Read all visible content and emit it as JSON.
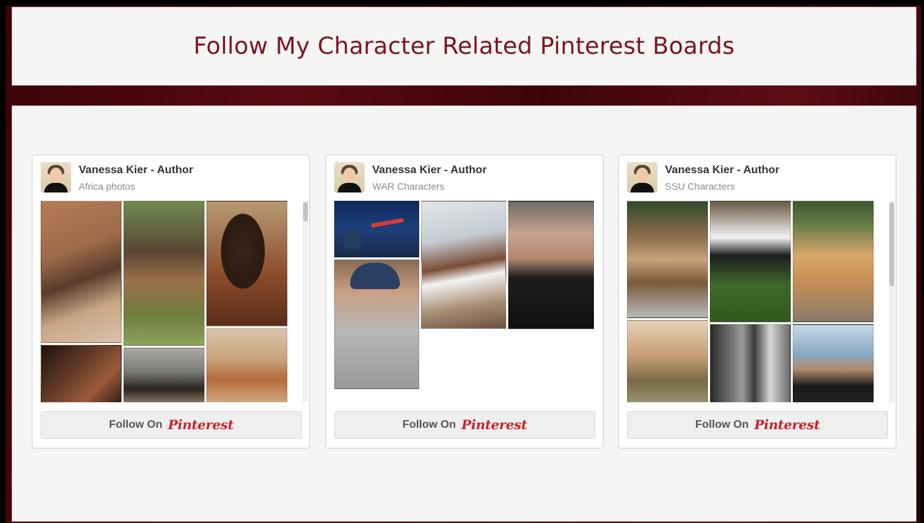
{
  "page": {
    "title": "Follow My Character Related Pinterest Boards"
  },
  "colors": {
    "accent": "#7a1520",
    "pinterest_red": "#cb2027",
    "frame": "#4a0810"
  },
  "widgets": [
    {
      "pinner": "Vanessa Kier - Author",
      "board": "Africa photos",
      "follow_label": "Follow On",
      "brand": "Pinterest",
      "scroll_position": 0.0,
      "images": [
        {
          "subject": "mud hut doorway with seated man"
        },
        {
          "subject": "women carrying pots on heads"
        },
        {
          "subject": "smiling woman with beaded necklaces"
        },
        {
          "subject": "child in doorway"
        },
        {
          "subject": "two children"
        },
        {
          "subject": "figure in ochre fabric"
        }
      ]
    },
    {
      "pinner": "Vanessa Kier - Author",
      "board": "WAR Characters",
      "follow_label": "Follow On",
      "brand": "Pinterest",
      "scroll_position": 0.0,
      "images": [
        {
          "subject": "dancers leaping on blue stage"
        },
        {
          "subject": "woman crouching in white dress"
        },
        {
          "subject": "man in black jacket"
        },
        {
          "subject": "man in grey hoodie and beanie"
        }
      ]
    },
    {
      "pinner": "Vanessa Kier - Author",
      "board": "SSU Characters",
      "follow_label": "Follow On",
      "brand": "Pinterest",
      "scroll_position": 0.0,
      "images": [
        {
          "subject": "red-tailed hawk on perch"
        },
        {
          "subject": "border collie on mossy stump"
        },
        {
          "subject": "golden retriever on deck"
        },
        {
          "subject": "couple on beach"
        },
        {
          "subject": "couple in black and white"
        },
        {
          "subject": "man in black t-shirt at sea"
        }
      ]
    }
  ]
}
